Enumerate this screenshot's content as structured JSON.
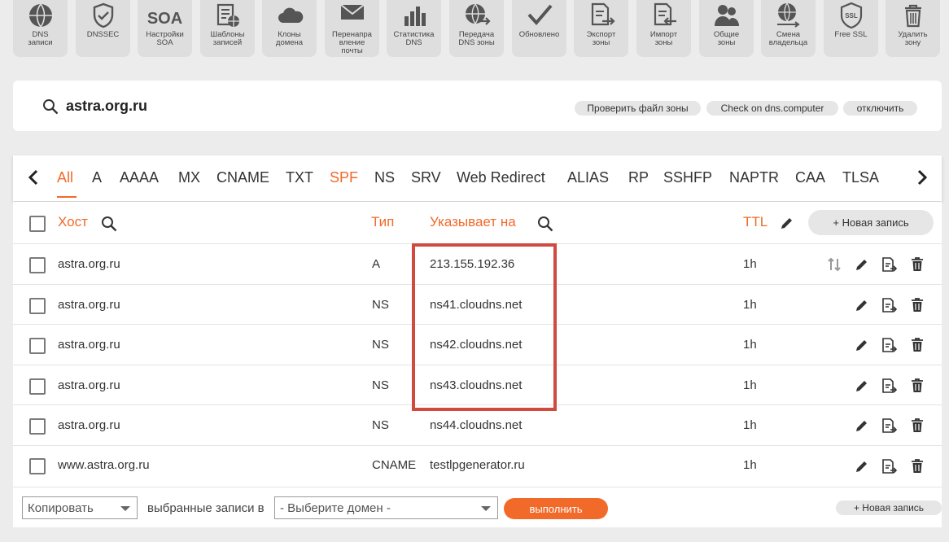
{
  "toolbar": {
    "items": [
      {
        "label": "DNS\nзаписи",
        "icon": "globe-icon"
      },
      {
        "label": "DNSSEC",
        "icon": "shield-icon"
      },
      {
        "label": "Настройки\nSOA",
        "icon": "soa-icon",
        "icon_text": "SOA"
      },
      {
        "label": "Шаблоны\nзаписей",
        "icon": "template-icon"
      },
      {
        "label": "Клоны\nдомена",
        "icon": "cloud-icon"
      },
      {
        "label": "Перенапра\nвление\nпочты",
        "icon": "mail-icon"
      },
      {
        "label": "Статистика\nDNS",
        "icon": "stats-icon"
      },
      {
        "label": "Передача\nDNS зоны",
        "icon": "transfer-icon"
      },
      {
        "label": "Обновлено",
        "icon": "check-icon"
      },
      {
        "label": "Экспорт\nзоны",
        "icon": "export-icon"
      },
      {
        "label": "Импорт\nзоны",
        "icon": "import-icon"
      },
      {
        "label": "Общие\nзоны",
        "icon": "users-icon"
      },
      {
        "label": "Смена\nвладельца",
        "icon": "owner-change-icon"
      },
      {
        "label": "Free SSL",
        "icon": "ssl-icon",
        "icon_text": "SSL"
      },
      {
        "label": "Удалить\nзону",
        "icon": "trash-icon"
      }
    ]
  },
  "zone": {
    "name": "astra.org.ru",
    "buttons": [
      "Проверить файл зоны",
      "Check on dns.computer",
      "отключить"
    ]
  },
  "tabs": {
    "items": [
      "All",
      "A",
      "AAAA",
      "MX",
      "CNAME",
      "TXT",
      "SPF",
      "NS",
      "SRV",
      "Web Redirect",
      "ALIAS",
      "RP",
      "SSHFP",
      "NAPTR",
      "CAA",
      "TLSA"
    ],
    "active": "All"
  },
  "table": {
    "headers": {
      "host": "Хост",
      "type": "Тип",
      "points_to": "Указывает на",
      "ttl": "TTL"
    },
    "new_record": "+ Новая запись",
    "rows": [
      {
        "host": "astra.org.ru",
        "type": "A",
        "value": "213.155.192.36",
        "ttl": "1h"
      },
      {
        "host": "astra.org.ru",
        "type": "NS",
        "value": "ns41.cloudns.net",
        "ttl": "1h"
      },
      {
        "host": "astra.org.ru",
        "type": "NS",
        "value": "ns42.cloudns.net",
        "ttl": "1h"
      },
      {
        "host": "astra.org.ru",
        "type": "NS",
        "value": "ns43.cloudns.net",
        "ttl": "1h"
      },
      {
        "host": "astra.org.ru",
        "type": "NS",
        "value": "ns44.cloudns.net",
        "ttl": "1h"
      },
      {
        "host": "www.astra.org.ru",
        "type": "CNAME",
        "value": "testlpgenerator.ru",
        "ttl": "1h"
      }
    ]
  },
  "bottom": {
    "action_select": "Копировать",
    "label": "выбранные записи в",
    "domain_select": "- Выберите домен -",
    "run": "выполнить",
    "new_record": "+ Новая запись"
  },
  "colors": {
    "accent": "#f26a2a",
    "highlight": "#d04a3f"
  }
}
